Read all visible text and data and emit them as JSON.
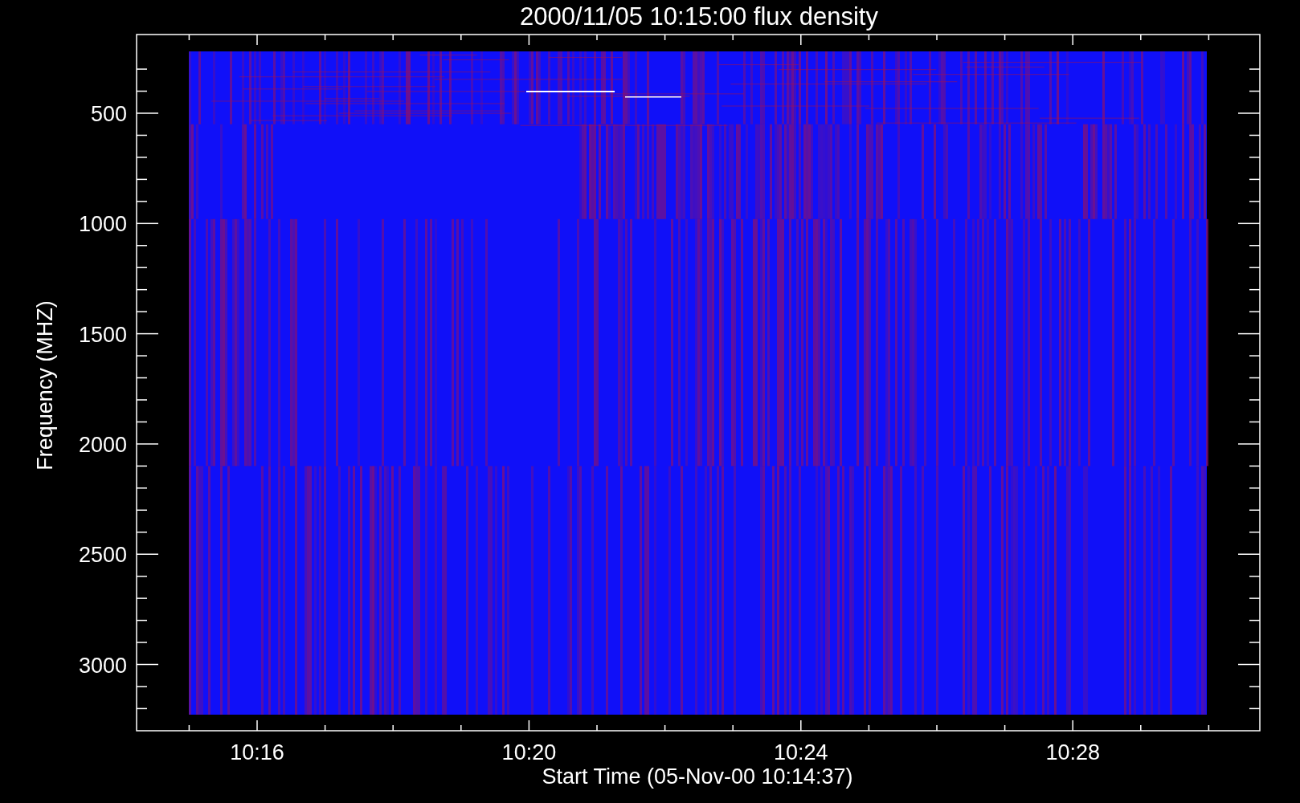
{
  "plot": {
    "title": "2000/11/05 10:15:00 flux density",
    "xlabel": "Start Time (05-Nov-00 10:14:37)",
    "ylabel": "Frequency (MHZ)",
    "xtick_labels": [
      "10:16",
      "10:20",
      "10:24",
      "10:28"
    ],
    "ytick_labels": [
      "500",
      "1000",
      "1500",
      "2000",
      "2500",
      "3000"
    ]
  }
}
